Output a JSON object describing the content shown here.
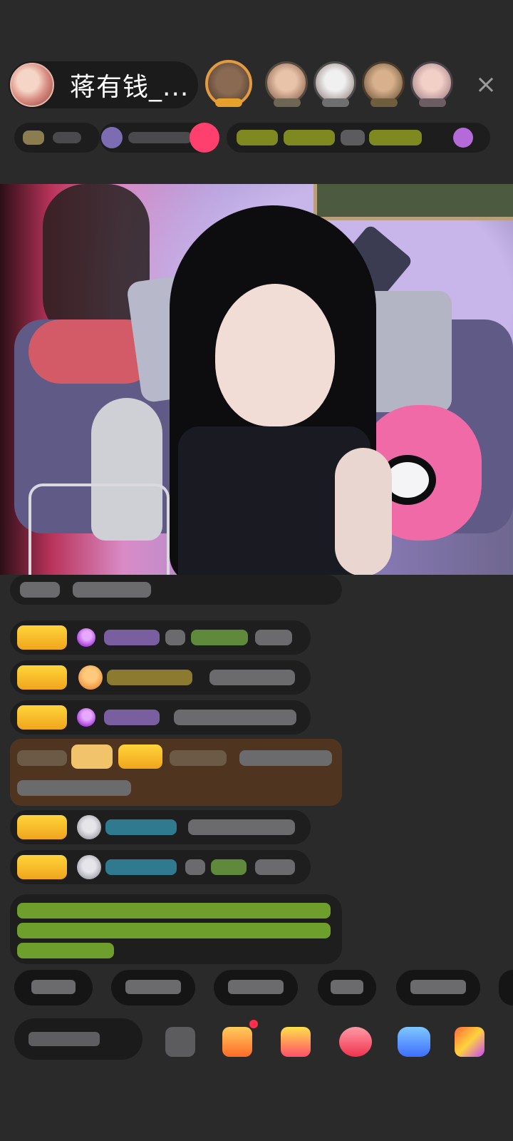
{
  "header": {
    "host_name": "蒋有钱_...",
    "close_symbol": "×"
  },
  "viewers": [
    {
      "icon": "viewer-avatar"
    },
    {
      "icon": "viewer-avatar"
    },
    {
      "icon": "viewer-avatar"
    },
    {
      "icon": "viewer-avatar"
    },
    {
      "icon": "viewer-avatar"
    }
  ],
  "colors": {
    "background": "#2a2a2b",
    "badge_gold": "#f0a51c",
    "gift_message_bg": "#4f3520",
    "first_viewer_ring": "#e49a3f"
  },
  "stream": {
    "icon": "live-video-feed"
  },
  "chat": {
    "messages": [
      {
        "type": "system",
        "icon": "none"
      },
      {
        "type": "user",
        "icon": "diamond-icon"
      },
      {
        "type": "user",
        "icon": "hand-icon"
      },
      {
        "type": "user",
        "icon": "diamond-icon"
      },
      {
        "type": "gift",
        "icon": "gift-badge"
      },
      {
        "type": "user",
        "icon": "gray-avatar-icon"
      },
      {
        "type": "user",
        "icon": "gray-avatar-icon"
      },
      {
        "type": "notice",
        "icon": "none"
      }
    ]
  },
  "quick_replies": [
    {},
    {},
    {},
    {},
    {}
  ],
  "bottom_bar": {
    "icons": [
      "emoji-icon",
      "gift-box-icon",
      "treasure-icon",
      "heart-icon",
      "game-controller-icon",
      "more-apps-icon"
    ]
  }
}
